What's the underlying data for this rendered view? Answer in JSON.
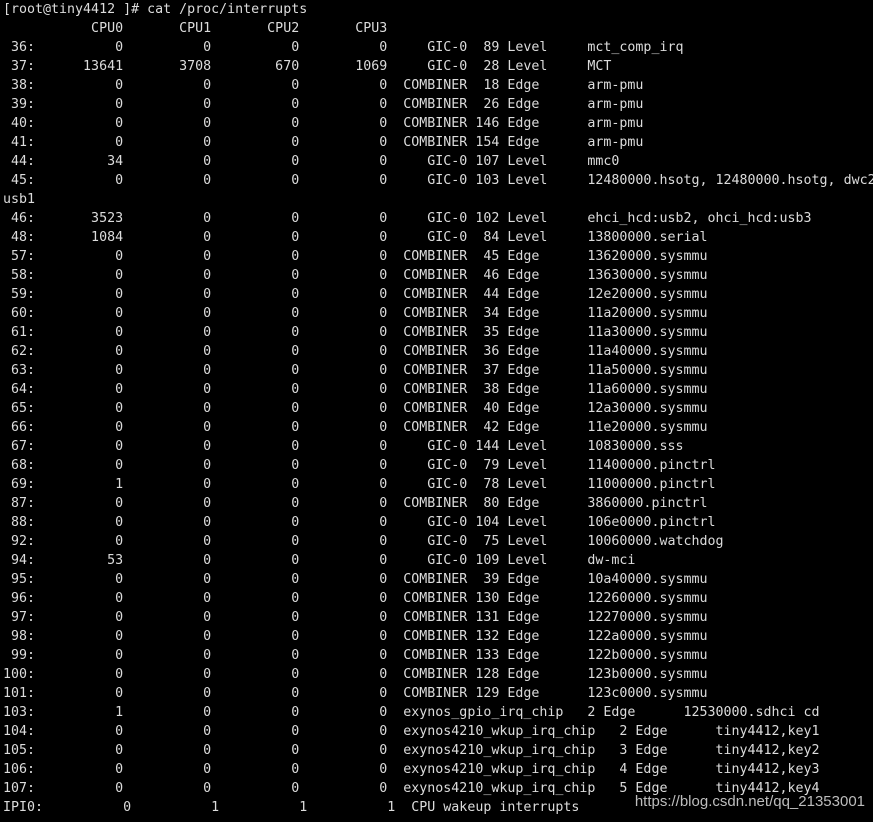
{
  "terminal": {
    "lines": [
      "[root@tiny4412 ]# cat /proc/interrupts",
      "           CPU0       CPU1       CPU2       CPU3",
      " 36:          0          0          0          0     GIC-0  89 Level     mct_comp_irq",
      " 37:      13641       3708        670       1069     GIC-0  28 Level     MCT",
      " 38:          0          0          0          0  COMBINER  18 Edge      arm-pmu",
      " 39:          0          0          0          0  COMBINER  26 Edge      arm-pmu",
      " 40:          0          0          0          0  COMBINER 146 Edge      arm-pmu",
      " 41:          0          0          0          0  COMBINER 154 Edge      arm-pmu",
      " 44:         34          0          0          0     GIC-0 107 Level     mmc0",
      " 45:          0          0          0          0     GIC-0 103 Level     12480000.hsotg, 12480000.hsotg, dwc2",
      "usb1",
      " 46:       3523          0          0          0     GIC-0 102 Level     ehci_hcd:usb2, ohci_hcd:usb3",
      " 48:       1084          0          0          0     GIC-0  84 Level     13800000.serial",
      " 57:          0          0          0          0  COMBINER  45 Edge      13620000.sysmmu",
      " 58:          0          0          0          0  COMBINER  46 Edge      13630000.sysmmu",
      " 59:          0          0          0          0  COMBINER  44 Edge      12e20000.sysmmu",
      " 60:          0          0          0          0  COMBINER  34 Edge      11a20000.sysmmu",
      " 61:          0          0          0          0  COMBINER  35 Edge      11a30000.sysmmu",
      " 62:          0          0          0          0  COMBINER  36 Edge      11a40000.sysmmu",
      " 63:          0          0          0          0  COMBINER  37 Edge      11a50000.sysmmu",
      " 64:          0          0          0          0  COMBINER  38 Edge      11a60000.sysmmu",
      " 65:          0          0          0          0  COMBINER  40 Edge      12a30000.sysmmu",
      " 66:          0          0          0          0  COMBINER  42 Edge      11e20000.sysmmu",
      " 67:          0          0          0          0     GIC-0 144 Level     10830000.sss",
      " 68:          0          0          0          0     GIC-0  79 Level     11400000.pinctrl",
      " 69:          1          0          0          0     GIC-0  78 Level     11000000.pinctrl",
      " 87:          0          0          0          0  COMBINER  80 Edge      3860000.pinctrl",
      " 88:          0          0          0          0     GIC-0 104 Level     106e0000.pinctrl",
      " 92:          0          0          0          0     GIC-0  75 Level     10060000.watchdog",
      " 94:         53          0          0          0     GIC-0 109 Level     dw-mci",
      " 95:          0          0          0          0  COMBINER  39 Edge      10a40000.sysmmu",
      " 96:          0          0          0          0  COMBINER 130 Edge      12260000.sysmmu",
      " 97:          0          0          0          0  COMBINER 131 Edge      12270000.sysmmu",
      " 98:          0          0          0          0  COMBINER 132 Edge      122a0000.sysmmu",
      " 99:          0          0          0          0  COMBINER 133 Edge      122b0000.sysmmu",
      "100:          0          0          0          0  COMBINER 128 Edge      123b0000.sysmmu",
      "101:          0          0          0          0  COMBINER 129 Edge      123c0000.sysmmu",
      "103:          1          0          0          0  exynos_gpio_irq_chip   2 Edge      12530000.sdhci cd",
      "104:          0          0          0          0  exynos4210_wkup_irq_chip   2 Edge      tiny4412,key1",
      "105:          0          0          0          0  exynos4210_wkup_irq_chip   3 Edge      tiny4412,key2",
      "106:          0          0          0          0  exynos4210_wkup_irq_chip   4 Edge      tiny4412,key3",
      "107:          0          0          0          0  exynos4210_wkup_irq_chip   5 Edge      tiny4412,key4",
      "IPI0:          0          1          1          1  CPU wakeup interrupts"
    ]
  },
  "watermark": {
    "text": "https://blog.csdn.net/qq_21353001"
  },
  "colors": {
    "background": "#000000",
    "foreground": "#dcdcdc",
    "watermark": "#bdbdbd"
  }
}
